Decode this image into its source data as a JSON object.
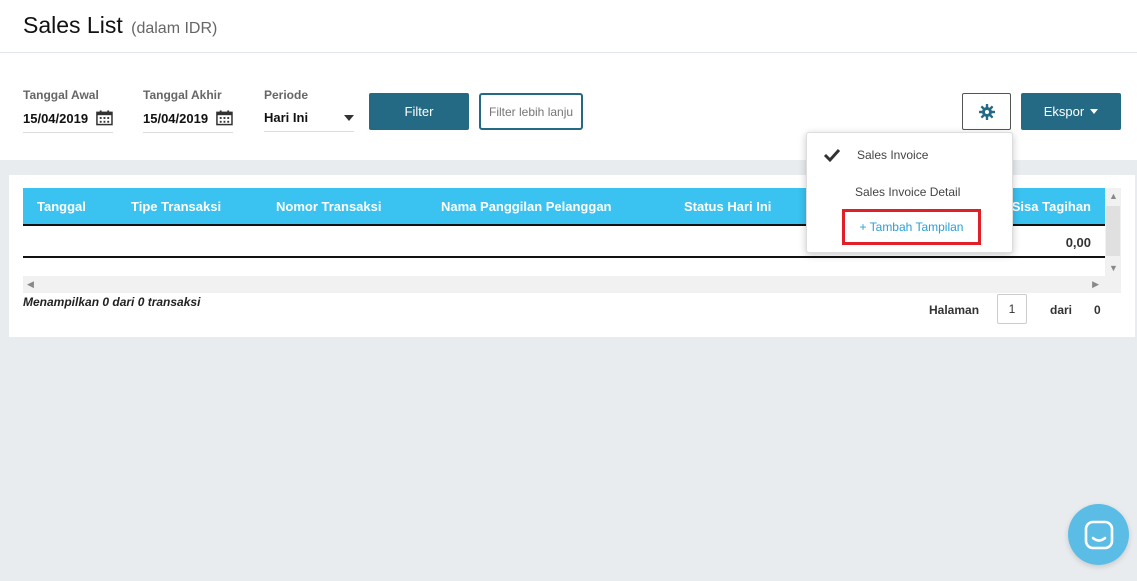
{
  "header": {
    "title": "Sales List",
    "subtitle": "(dalam IDR)"
  },
  "filters": {
    "start_date": {
      "label": "Tanggal Awal",
      "value": "15/04/2019",
      "icon": "calendar-icon"
    },
    "end_date": {
      "label": "Tanggal Akhir",
      "value": "15/04/2019",
      "icon": "calendar-icon"
    },
    "period": {
      "label": "Periode",
      "value": "Hari Ini"
    },
    "filter_button": "Filter",
    "advanced_filter_placeholder": "Filter lebih lanjut",
    "settings_icon": "gear-icon",
    "export_button": "Ekspor"
  },
  "dropdown": {
    "items": [
      {
        "label": "Sales Invoice",
        "checked": true
      },
      {
        "label": "Sales Invoice Detail",
        "checked": false
      }
    ],
    "add_label": "+ Tambah Tampilan"
  },
  "table": {
    "columns": [
      "Tanggal",
      "Tipe Transaksi",
      "Nomor Transaksi",
      "Nama Panggilan Pelanggan",
      "Status Hari Ini",
      "Sisa Tagihan"
    ],
    "total": "0,00"
  },
  "summary": "Menampilkan 0 dari 0 transaksi",
  "pager": {
    "page_label": "Halaman",
    "page_value": "1",
    "of_label": "dari",
    "total_pages": "0"
  },
  "colors": {
    "accent": "#246a84",
    "table_header": "#3ac2f0",
    "highlight": "#e01f26",
    "link": "#2a9fd6",
    "chat": "#5bbde6"
  }
}
